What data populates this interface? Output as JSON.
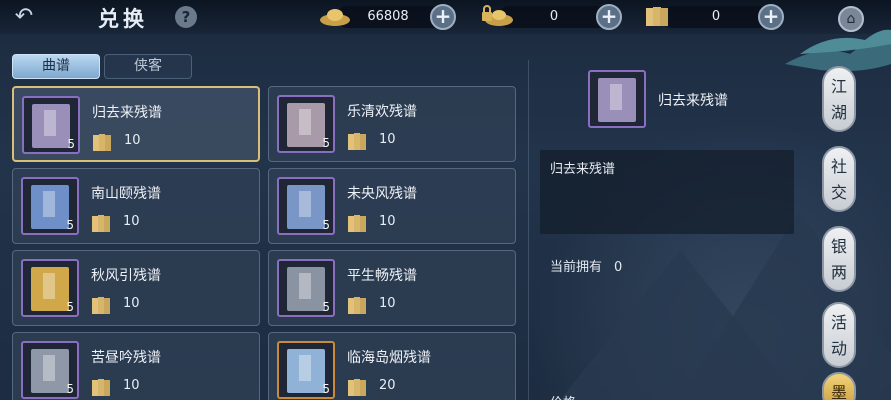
{
  "header": {
    "title": "兑换",
    "help": "?",
    "resources": [
      {
        "icon": "silver-ingot-icon",
        "value": "66808"
      },
      {
        "icon": "locked-ingot-icon",
        "value": "0"
      },
      {
        "icon": "scroll-book-icon",
        "value": "0"
      }
    ]
  },
  "tabs": [
    {
      "label": "曲谱",
      "active": true
    },
    {
      "label": "侠客",
      "active": false
    }
  ],
  "items": [
    {
      "name": "归去来残谱",
      "qty": "5",
      "cost": "10",
      "color": "#9a8fb8",
      "selected": true
    },
    {
      "name": "乐清欢残谱",
      "qty": "5",
      "cost": "10",
      "color": "#a89aa8",
      "selected": false
    },
    {
      "name": "南山颐残谱",
      "qty": "5",
      "cost": "10",
      "color": "#6f8fc8",
      "selected": false
    },
    {
      "name": "未央风残谱",
      "qty": "5",
      "cost": "10",
      "color": "#7a96c6",
      "selected": false
    },
    {
      "name": "秋风引残谱",
      "qty": "5",
      "cost": "10",
      "color": "#d0a84a",
      "selected": false
    },
    {
      "name": "平生畅残谱",
      "qty": "5",
      "cost": "10",
      "color": "#8a93a2",
      "selected": false
    },
    {
      "name": "苦昼吟残谱",
      "qty": "5",
      "cost": "10",
      "color": "#8e98a8",
      "selected": false
    },
    {
      "name": "临海岛烟残谱",
      "qty": "5",
      "cost": "20",
      "color": "#8fb2d6",
      "selected": false
    }
  ],
  "detail": {
    "name": "归去来残谱",
    "description": "归去来残谱",
    "owned_label": "当前拥有",
    "owned_value": "0",
    "price_label": "价格"
  },
  "sidenav": [
    {
      "label": "江湖"
    },
    {
      "label": "社交"
    },
    {
      "label": "银两"
    },
    {
      "label": "活动"
    },
    {
      "label": "墨"
    }
  ]
}
